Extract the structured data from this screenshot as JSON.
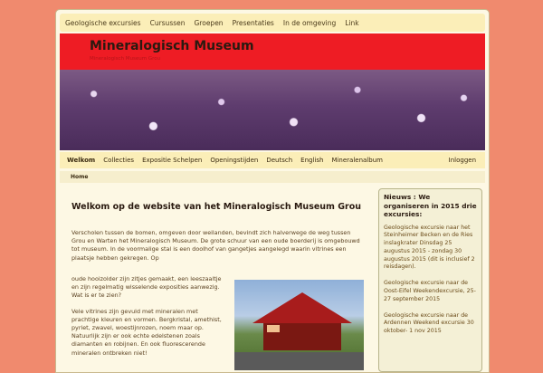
{
  "topnav": {
    "items": [
      "Geologische excursies",
      "Cursussen",
      "Groepen",
      "Presentaties",
      "In de omgeving",
      "Link"
    ]
  },
  "header": {
    "title": "Mineralogisch Museum",
    "tagline": "Mineralogisch Museum Grou"
  },
  "mainnav": {
    "items": [
      "Welkom",
      "Collecties",
      "Expositie Schelpen",
      "Openingstijden",
      "Deutsch",
      "English",
      "Mineralenalbum"
    ],
    "login": "Inloggen"
  },
  "breadcrumb": {
    "home": "Home"
  },
  "content": {
    "heading": "Welkom op de website van het Mineralogisch Museum Grou",
    "intro": "Verscholen tussen de bomen, omgeven door weilanden, bevindt zich halverwege de weg tussen Grou en Warten het Mineralogisch Museum. De grote schuur van een oude boerderij is omgebouwd tot museum. In de voormalige stal is een doolhof van gangetjes aangelegd waarin vitrines een plaatsje hebben gekregen. Op",
    "para1": "oude hooizolder zijn zitjes gemaakt, een leeszaaltje en zijn regelmatig wisselende exposities aanwezig. Wat is er te zien?",
    "para2": "Vele vitrines zijn gevuld met mineralen met prachtige kleuren en vormen. Bergkristal, amethist, pyriet, zwavel, woestijnrozen, noem maar op. Natuurlijk zijn er ook echte edelstenen zoals diamanten en robijnen. En ook fluorescerende mineralen ontbreken niet!"
  },
  "sidebar": {
    "heading": "Nieuws : We organiseren in 2015 drie excursies:",
    "news": [
      "Geologische excursie naar het Steinheimer Becken en de Ries inslagkrater Dinsdag 25 augustus 2015 - zondag 30 augustus 2015 (dit is inclusief 2 reisdagen).",
      "Geologische excursie naar de Oost-Eifel Weekendexcursie, 25-27 september 2015",
      "Geologische excursie naar de Ardennen Weekend excursie 30 oktober- 1 nov 2015"
    ]
  },
  "colors": {
    "background": "#f08a6e",
    "header_red": "#ee1c24",
    "nav_bg": "#fbeeb8",
    "page_bg": "#fdf8e4"
  }
}
